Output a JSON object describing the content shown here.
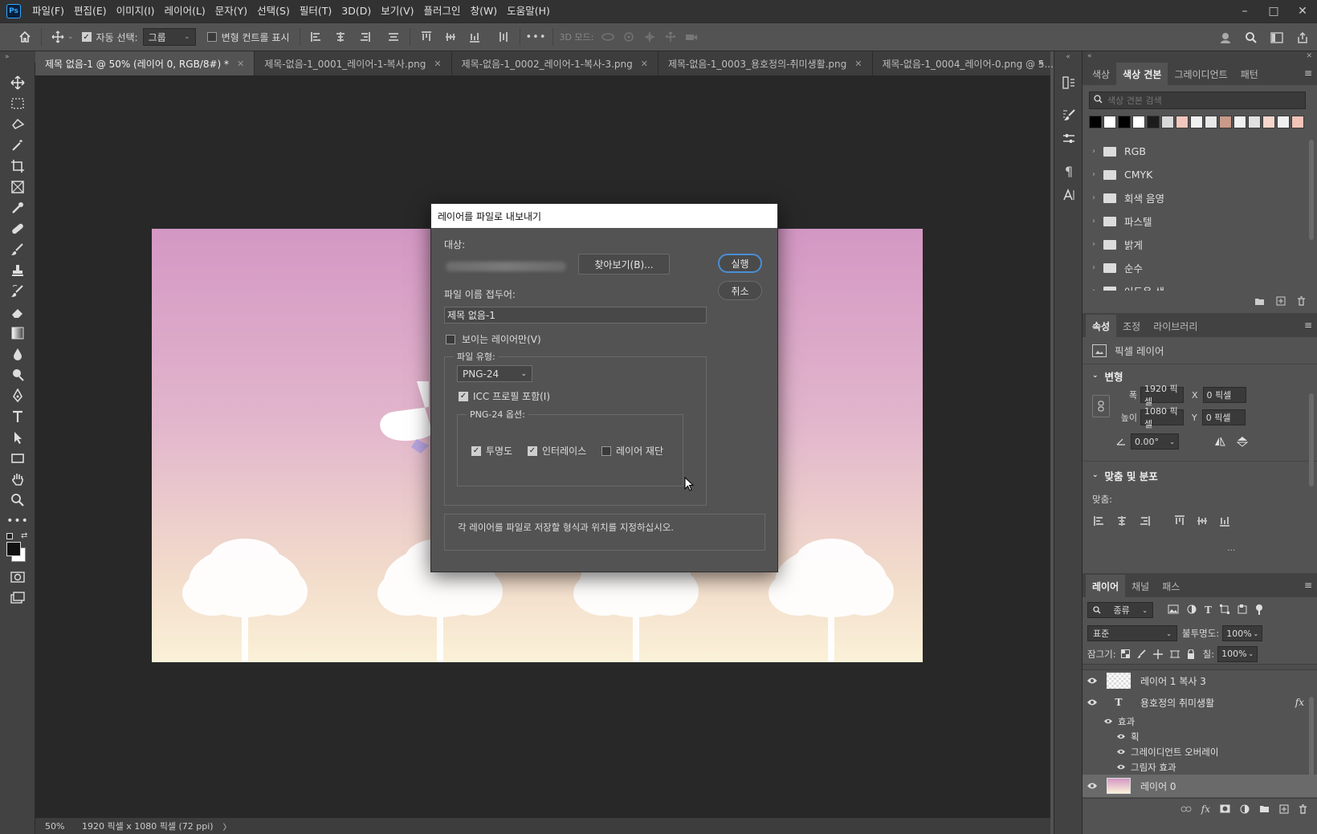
{
  "app": {
    "logo": "Ps"
  },
  "menubar": {
    "items": [
      "파일(F)",
      "편집(E)",
      "이미지(I)",
      "레이어(L)",
      "문자(Y)",
      "선택(S)",
      "필터(T)",
      "3D(D)",
      "보기(V)",
      "플러그인",
      "창(W)",
      "도움말(H)"
    ]
  },
  "window_controls": {
    "minimize": "–",
    "maximize": "□",
    "close": "✕"
  },
  "options": {
    "auto_select_label": "자동 선택:",
    "auto_select_value": "그룹",
    "transform_controls_label": "변형 컨트롤 표시",
    "mode_3d_label": "3D 모드:",
    "more": "•••"
  },
  "tabs": [
    {
      "label": "제목 없음-1 @ 50% (레이어 0, RGB/8#) *",
      "active": true
    },
    {
      "label": "제목-없음-1_0001_레이어-1-복사.png",
      "active": false
    },
    {
      "label": "제목-없음-1_0002_레이어-1-복사-3.png",
      "active": false
    },
    {
      "label": "제목-없음-1_0003_용호정의-취미생활.png",
      "active": false
    },
    {
      "label": "제목-없음-1_0004_레이어-0.png @ 5...",
      "active": false
    }
  ],
  "status": {
    "zoom": "50%",
    "doc_info": "1920 픽셀 x 1080 픽셀 (72 ppi)",
    "arrow": "〉"
  },
  "swatches_panel": {
    "tabs": [
      "색상",
      "색상 견본",
      "그레이디언트",
      "패턴"
    ],
    "active_tab": 1,
    "search_placeholder": "색상 견본 검색",
    "colors": [
      "#000000",
      "#ffffff",
      "#000000",
      "#ffffff",
      "#1c1c1c",
      "#d9d9d9",
      "#f2c7bd",
      "#f0f0f0",
      "#e8e8e8",
      "#c99a89",
      "#f2f2f2",
      "#e0e0e0",
      "#f5d6cc",
      "#f0f0f0",
      "#f2c4b8"
    ],
    "folders": [
      "RGB",
      "CMYK",
      "회색 음영",
      "파스텔",
      "밝게",
      "순수",
      "어두운 색"
    ]
  },
  "properties_panel": {
    "tabs": [
      "속성",
      "조정",
      "라이브러리"
    ],
    "active_tab": 0,
    "layer_type": "픽셀 레이어",
    "transform_section": "변형",
    "width_label": "폭",
    "width_value": "1920 픽셀",
    "height_label": "높이",
    "height_value": "1080 픽셀",
    "x_label": "X",
    "x_value": "0 픽셀",
    "y_label": "Y",
    "y_value": "0 픽셀",
    "angle_value": "0.00°",
    "align_section": "맞춤 및 분포",
    "align_label": "맞춤:",
    "more": "..."
  },
  "layers_panel": {
    "tabs": [
      "레이어",
      "채널",
      "패스"
    ],
    "active_tab": 0,
    "filter_kind": "종류",
    "blend_mode": "표준",
    "opacity_label": "불투명도:",
    "opacity_value": "100%",
    "lock_label": "잠그기:",
    "fill_label": "칠:",
    "fill_value": "100%",
    "layers": [
      {
        "name": "레이어 1 복사 3",
        "kind": "pixel"
      },
      {
        "name": "용호정의 취미생활",
        "kind": "text",
        "fx": "fx"
      },
      {
        "name": "효과",
        "kind": "effects-header"
      },
      {
        "name": "획",
        "kind": "effect"
      },
      {
        "name": "그레이디언트 오버레이",
        "kind": "effect"
      },
      {
        "name": "그림자 효과",
        "kind": "effect"
      },
      {
        "name": "레이어 0",
        "kind": "pixel",
        "selected": true
      }
    ]
  },
  "dialog": {
    "title": "레이어를 파일로 내보내기",
    "destination_label": "대상:",
    "browse_button": "찾아보기(B)...",
    "run_button": "실행",
    "cancel_button": "취소",
    "prefix_label": "파일 이름 접두어:",
    "prefix_value": "제목 없음-1",
    "visible_only_label": "보이는 레이어만(V)",
    "visible_only_checked": false,
    "filetype_legend": "파일 유형:",
    "filetype_value": "PNG-24",
    "icc_label": "ICC 프로필 포함(I)",
    "icc_checked": true,
    "png_options_legend": "PNG-24 옵션:",
    "transparency_label": "투명도",
    "transparency_checked": true,
    "interlace_label": "인터레이스",
    "interlace_checked": true,
    "trim_label": "레이어 재단",
    "trim_checked": false,
    "description": "각 레이어를 파일로 저장할 형식과 위치를 지정하십시오."
  }
}
